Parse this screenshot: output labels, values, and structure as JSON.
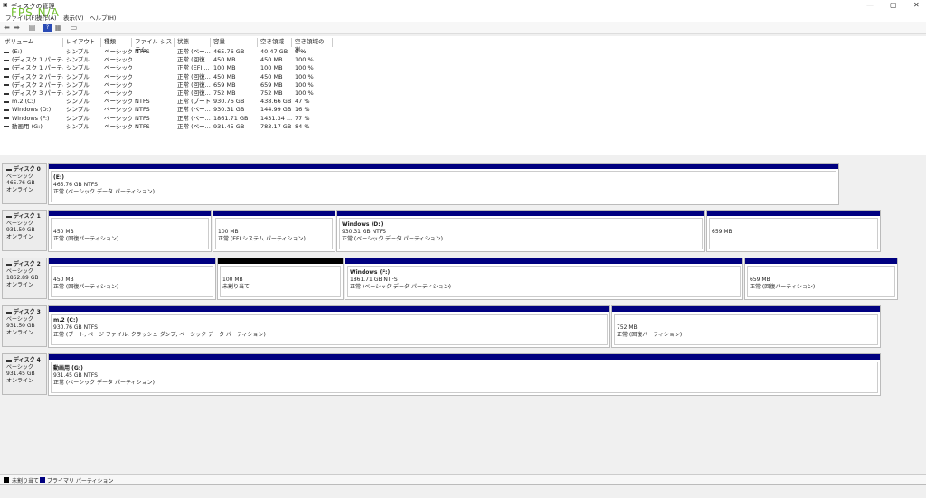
{
  "window": {
    "title": "ディスクの管理",
    "overlay": "FPS N/A",
    "minimize": "—",
    "maximize": "▢",
    "close": "✕"
  },
  "menu": [
    "ファイル(F)",
    "操作(A)",
    "表示(V)",
    "ヘルプ(H)"
  ],
  "toolbar": [
    "back-icon",
    "forward-icon",
    "properties-icon",
    "help-icon",
    "view-icon",
    "console-icon"
  ],
  "columns": [
    "ボリューム",
    "レイアウト",
    "種類",
    "ファイル システム",
    "状態",
    "容量",
    "空き領域",
    "空き領域の割..."
  ],
  "rows": [
    [
      "(E:)",
      "シンプル",
      "ベーシック",
      "NTFS",
      "正常 (ベー...",
      "465.76 GB",
      "40.47 GB",
      "9 %"
    ],
    [
      "(ディスク 1 パーティシ...",
      "シンプル",
      "ベーシック",
      "",
      "正常 (回復...",
      "450 MB",
      "450 MB",
      "100 %"
    ],
    [
      "(ディスク 1 パーティシ...",
      "シンプル",
      "ベーシック",
      "",
      "正常 (EFI ...",
      "100 MB",
      "100 MB",
      "100 %"
    ],
    [
      "(ディスク 2 パーティシ...",
      "シンプル",
      "ベーシック",
      "",
      "正常 (回復...",
      "450 MB",
      "450 MB",
      "100 %"
    ],
    [
      "(ディスク 2 パーティシ...",
      "シンプル",
      "ベーシック",
      "",
      "正常 (回復...",
      "659 MB",
      "659 MB",
      "100 %"
    ],
    [
      "(ディスク 3 パーティシ...",
      "シンプル",
      "ベーシック",
      "",
      "正常 (回復...",
      "752 MB",
      "752 MB",
      "100 %"
    ],
    [
      "m.2 (C:)",
      "シンプル",
      "ベーシック",
      "NTFS",
      "正常 (ブート...",
      "930.76 GB",
      "438.66 GB",
      "47 %"
    ],
    [
      "Windows (D:)",
      "シンプル",
      "ベーシック",
      "NTFS",
      "正常 (ベー...",
      "930.31 GB",
      "144.99 GB",
      "16 %"
    ],
    [
      "Windows (F:)",
      "シンプル",
      "ベーシック",
      "NTFS",
      "正常 (ベー...",
      "1861.71 GB",
      "1431.34 ...",
      "77 %"
    ],
    [
      "動画用 (G:)",
      "シンプル",
      "ベーシック",
      "NTFS",
      "正常 (ベー...",
      "931.45 GB",
      "783.17 GB",
      "84 %"
    ]
  ],
  "disks": [
    {
      "name": "ディスク 0",
      "type": "ベーシック",
      "size": "465.76 GB",
      "status": "オンライン",
      "partitions": [
        {
          "name": "(E:)",
          "size": "465.76 GB NTFS",
          "status": "正常 (ベーシック データ パーティション)",
          "kind": "primary"
        }
      ]
    },
    {
      "name": "ディスク 1",
      "type": "ベーシック",
      "size": "931.50 GB",
      "status": "オンライン",
      "partitions": [
        {
          "name": "",
          "size": "450 MB",
          "status": "正常 (回復パーティション)",
          "kind": "primary"
        },
        {
          "name": "",
          "size": "100 MB",
          "status": "正常 (EFI システム パーティション)",
          "kind": "primary"
        },
        {
          "name": "Windows  (D:)",
          "size": "930.31 GB NTFS",
          "status": "正常 (ベーシック データ パーティション)",
          "kind": "primary"
        },
        {
          "name": "",
          "size": "659 MB",
          "status": "",
          "kind": "primary"
        }
      ]
    },
    {
      "name": "ディスク 2",
      "type": "ベーシック",
      "size": "1862.89 GB",
      "status": "オンライン",
      "partitions": [
        {
          "name": "",
          "size": "450 MB",
          "status": "正常 (回復パーティション)",
          "kind": "primary"
        },
        {
          "name": "",
          "size": "100 MB",
          "status": "未割り当て",
          "kind": "unallocated"
        },
        {
          "name": "Windows  (F:)",
          "size": "1861.71 GB NTFS",
          "status": "正常 (ベーシック データ パーティション)",
          "kind": "primary"
        },
        {
          "name": "",
          "size": "659 MB",
          "status": "正常 (回復パーティション)",
          "kind": "primary"
        }
      ]
    },
    {
      "name": "ディスク 3",
      "type": "ベーシック",
      "size": "931.50 GB",
      "status": "オンライン",
      "partitions": [
        {
          "name": "m.2  (C:)",
          "size": "930.76 GB NTFS",
          "status": "正常 (ブート, ページ ファイル, クラッシュ ダンプ, ベーシック データ パーティション)",
          "kind": "primary"
        },
        {
          "name": "",
          "size": "752 MB",
          "status": "正常 (回復パーティション)",
          "kind": "primary"
        }
      ]
    },
    {
      "name": "ディスク 4",
      "type": "ベーシック",
      "size": "931.45 GB",
      "status": "オンライン",
      "partitions": [
        {
          "name": "動画用  (G:)",
          "size": "931.45 GB NTFS",
          "status": "正常 (ベーシック データ パーティション)",
          "kind": "primary"
        }
      ]
    }
  ],
  "legend": [
    {
      "label": "未割り当て",
      "color": "#000000"
    },
    {
      "label": "プライマリ パーティション",
      "color": "#000080"
    }
  ],
  "colors": {
    "primary": "#000080",
    "unallocated": "#000000",
    "overlay": "#6fbf2a"
  }
}
